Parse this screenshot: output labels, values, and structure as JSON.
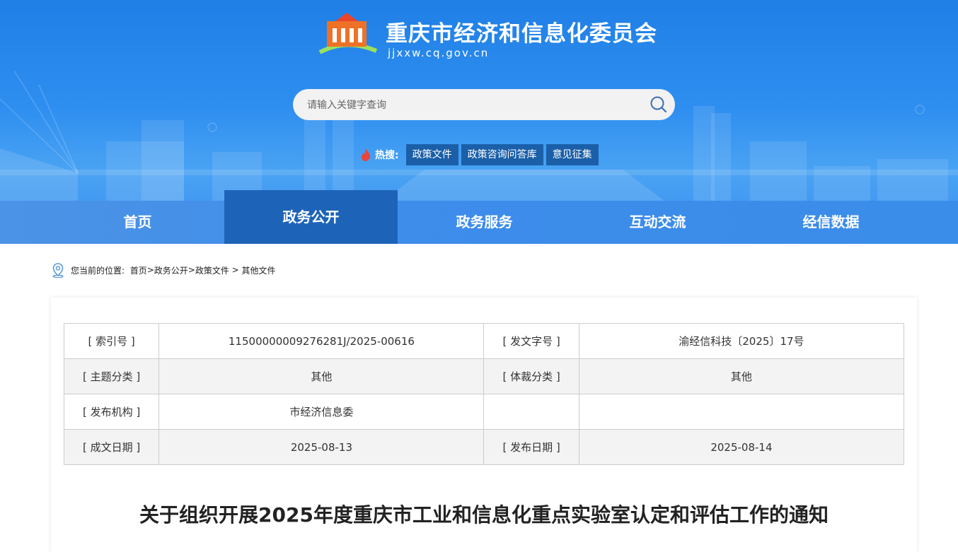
{
  "header": {
    "site_title": "重庆市经济和信息化委员会",
    "site_domain": "jjxxw.cq.gov.cn",
    "logo_icon": "cq-jjxxw-logo-icon",
    "search": {
      "placeholder": "请输入关键字查询",
      "value": ""
    },
    "hot_label": "热搜:",
    "hot_tags": [
      "政策文件",
      "政策咨询问答库",
      "意见征集"
    ]
  },
  "nav": {
    "items": [
      {
        "label": "首页",
        "active": false
      },
      {
        "label": "政务公开",
        "active": true
      },
      {
        "label": "政务服务",
        "active": false
      },
      {
        "label": "互动交流",
        "active": false
      },
      {
        "label": "经信数据",
        "active": false
      }
    ]
  },
  "breadcrumb": {
    "prefix": "您当前的位置:",
    "items": [
      "首页",
      ">",
      "政务公开",
      ">",
      "政策文件",
      " > ",
      "其他文件"
    ]
  },
  "meta": {
    "rows": [
      [
        "[ 索引号 ]",
        "11500000009276281J/2025-00616",
        "[ 发文字号 ]",
        "渝经信科技〔2025〕17号"
      ],
      [
        "[ 主题分类 ]",
        "其他",
        "[ 体裁分类 ]",
        "其他"
      ],
      [
        "[ 发布机构 ]",
        "市经济信息委",
        "",
        ""
      ],
      [
        "[ 成文日期 ]",
        "2025-08-13",
        "[ 发布日期 ]",
        "2025-08-14"
      ]
    ]
  },
  "document": {
    "title": "关于组织开展2025年度重庆市工业和信息化重点实验室认定和评估工作的通知"
  },
  "colors": {
    "banner_top": "#1f7fe6",
    "nav_bg": "#3d8ceb",
    "nav_active": "#1d64b8",
    "hot_tag_bg": "#1a5fa8"
  }
}
